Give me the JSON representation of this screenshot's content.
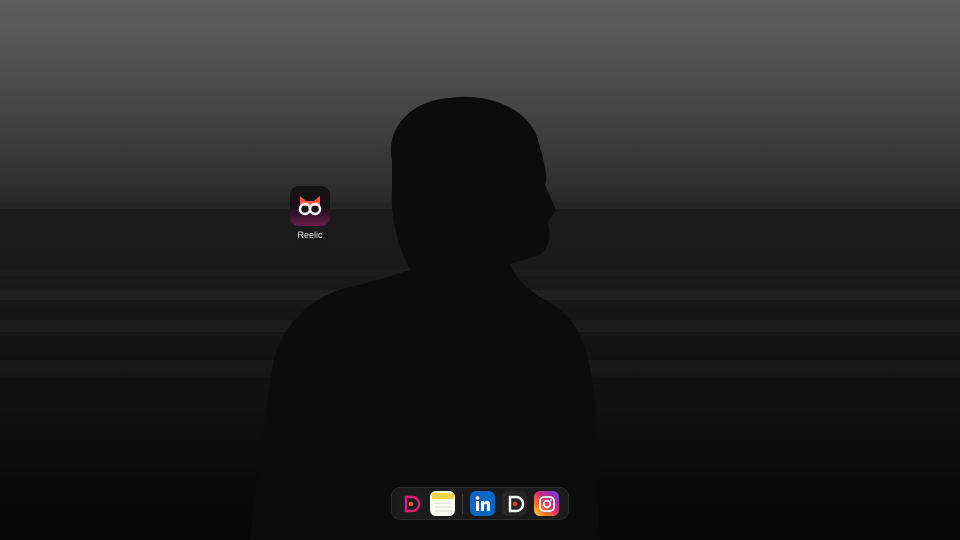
{
  "desktop": {
    "icons": [
      {
        "label": "Reelic",
        "icon": "reelic-app-icon"
      }
    ]
  },
  "dock": {
    "items": [
      {
        "name": "reelic-d-app",
        "icon": "reelic-d-icon"
      },
      {
        "name": "notes",
        "icon": "notes-icon"
      },
      {
        "name": "linkedin",
        "icon": "linkedin-icon"
      },
      {
        "name": "reelic-dark",
        "icon": "reelic-dark-icon"
      },
      {
        "name": "instagram",
        "icon": "instagram-icon"
      }
    ]
  },
  "colors": {
    "reelic_orange": "#ff5a3c",
    "reelic_magenta": "#e2187a",
    "linkedin_blue": "#0a66c2",
    "notes_yellow": "#f7d24b"
  }
}
